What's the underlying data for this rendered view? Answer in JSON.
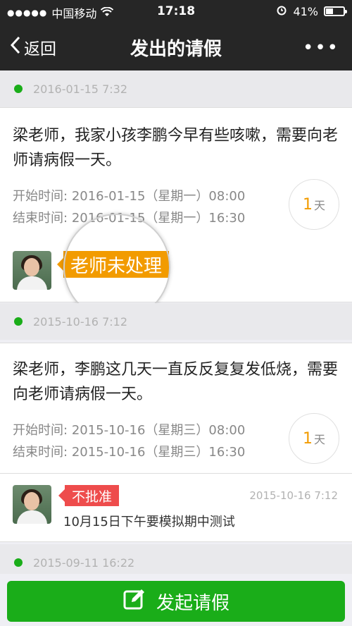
{
  "status_bar": {
    "carrier": "中国移动",
    "time": "17:18",
    "battery": "41%",
    "battery_level": 0.41
  },
  "nav": {
    "back_label": "返回",
    "title": "发出的请假",
    "more_label": "•••"
  },
  "requests": [
    {
      "date": "2016-01-15 7:32",
      "message": "梁老师，我家小孩李鹏今早有些咳嗽，需要向老师请病假一天。",
      "start_label": "开始时间:",
      "start": "2016-01-15（星期一）08:00",
      "end_label": "结束时间:",
      "end": "2016-01-15（星期一）16:30",
      "days_num": "1",
      "days_unit": "天",
      "status": "老师未处理"
    },
    {
      "date": "2015-10-16 7:12",
      "message": "梁老师，李鹏这几天一直反反复复发低烧，需要向老师请病假一天。",
      "start_label": "开始时间:",
      "start": "2015-10-16（星期三）08:00",
      "end_label": "结束时间:",
      "end": "2015-10-16（星期三）16:30",
      "days_num": "1",
      "days_unit": "天",
      "status": "不批准",
      "status_time": "2015-10-16 7:12",
      "reply": "10月15日下午要模拟期中测试"
    },
    {
      "date": "2015-09-11 16:22"
    }
  ],
  "footer": {
    "button_label": "发起请假"
  },
  "colors": {
    "accent_green": "#1aad19",
    "pending_orange": "#f29b00",
    "reject_red": "#ee4c4c"
  },
  "icons": [
    "signal-dots-icon",
    "wifi-icon",
    "alarm-icon",
    "battery-icon",
    "back-chevron-icon",
    "more-icon",
    "edit-icon"
  ]
}
